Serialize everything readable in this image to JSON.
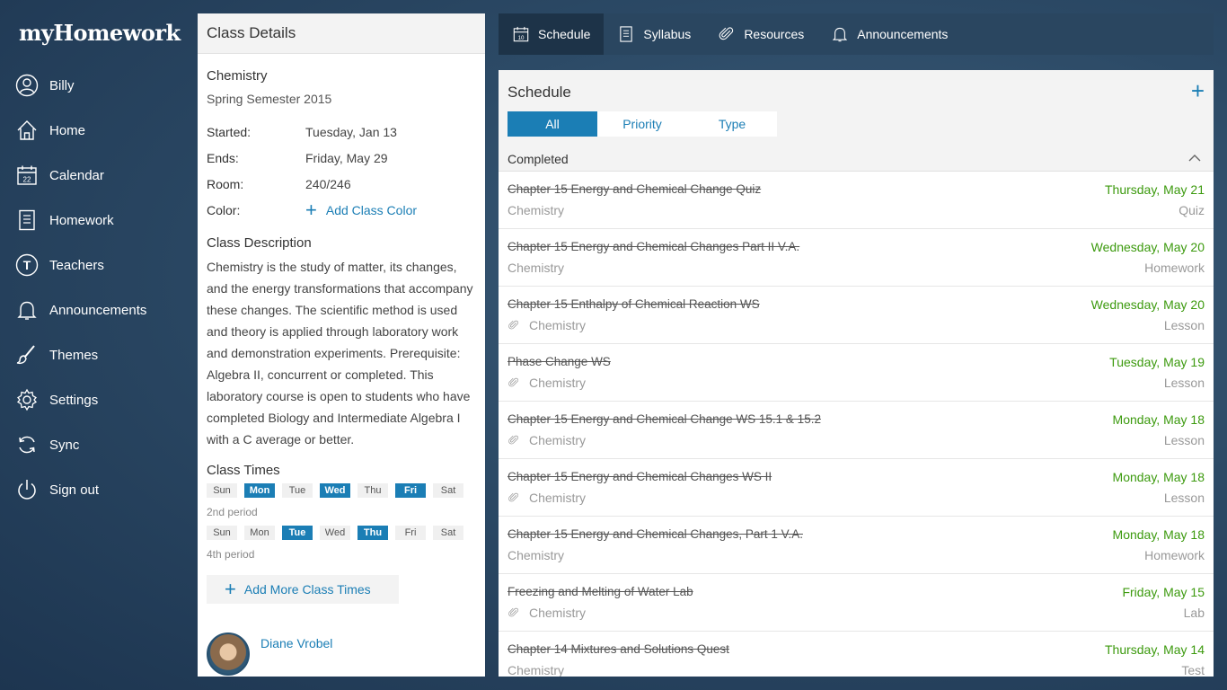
{
  "app": {
    "logo": "myHomework"
  },
  "sidebar": {
    "items": [
      {
        "label": "Billy",
        "icon": "user-icon"
      },
      {
        "label": "Home",
        "icon": "home-icon"
      },
      {
        "label": "Calendar",
        "icon": "calendar-icon"
      },
      {
        "label": "Homework",
        "icon": "document-icon"
      },
      {
        "label": "Teachers",
        "icon": "teacher-icon"
      },
      {
        "label": "Announcements",
        "icon": "bell-icon"
      },
      {
        "label": "Themes",
        "icon": "brush-icon"
      },
      {
        "label": "Settings",
        "icon": "gear-icon"
      },
      {
        "label": "Sync",
        "icon": "sync-icon"
      },
      {
        "label": "Sign out",
        "icon": "power-icon"
      }
    ]
  },
  "details": {
    "header": "Class Details",
    "class_name": "Chemistry",
    "semester": "Spring Semester 2015",
    "started_label": "Started:",
    "started_value": "Tuesday, Jan 13",
    "ends_label": "Ends:",
    "ends_value": "Friday, May 29",
    "room_label": "Room:",
    "room_value": "240/246",
    "color_label": "Color:",
    "add_color": "Add Class Color",
    "desc_title": "Class Description",
    "description": "Chemistry is the study of matter, its changes, and the energy transformations that accompany these changes. The scientific method is used and theory is applied through laboratory work and demonstration experiments. Prerequisite: Algebra II, concurrent or completed. This laboratory course is open to students who have completed Biology and Intermediate Algebra I with a C average or better.",
    "times_title": "Class Times",
    "time_sets": [
      {
        "days": [
          {
            "label": "Sun",
            "on": false
          },
          {
            "label": "Mon",
            "on": true
          },
          {
            "label": "Tue",
            "on": false
          },
          {
            "label": "Wed",
            "on": true
          },
          {
            "label": "Thu",
            "on": false
          },
          {
            "label": "Fri",
            "on": true
          },
          {
            "label": "Sat",
            "on": false
          }
        ],
        "period": "2nd period"
      },
      {
        "days": [
          {
            "label": "Sun",
            "on": false
          },
          {
            "label": "Mon",
            "on": false
          },
          {
            "label": "Tue",
            "on": true
          },
          {
            "label": "Wed",
            "on": false
          },
          {
            "label": "Thu",
            "on": true
          },
          {
            "label": "Fri",
            "on": false
          },
          {
            "label": "Sat",
            "on": false
          }
        ],
        "period": "4th period"
      }
    ],
    "add_times": "Add More Class Times",
    "teacher_name": "Diane Vrobel"
  },
  "tabs": [
    {
      "label": "Schedule",
      "icon": "calendar-icon",
      "active": true
    },
    {
      "label": "Syllabus",
      "icon": "document-icon",
      "active": false
    },
    {
      "label": "Resources",
      "icon": "paperclip-icon",
      "active": false
    },
    {
      "label": "Announcements",
      "icon": "bell-icon",
      "active": false
    }
  ],
  "tab_calendar_day": "10",
  "schedule": {
    "title": "Schedule",
    "filters": [
      {
        "label": "All",
        "active": true
      },
      {
        "label": "Priority",
        "active": false
      },
      {
        "label": "Type",
        "active": false
      }
    ],
    "section": "Completed",
    "items": [
      {
        "title": "Chapter 15 Energy and Chemical Change Quiz",
        "class": "Chemistry",
        "date": "Thursday, May 21",
        "type": "Quiz",
        "attachment": false
      },
      {
        "title": "Chapter 15 Energy and Chemical Changes Part II V.A.",
        "class": "Chemistry",
        "date": "Wednesday, May 20",
        "type": "Homework",
        "attachment": false
      },
      {
        "title": "Chapter 15 Enthalpy of Chemical Reaction WS",
        "class": "Chemistry",
        "date": "Wednesday, May 20",
        "type": "Lesson",
        "attachment": true
      },
      {
        "title": "Phase Change WS",
        "class": "Chemistry",
        "date": "Tuesday, May 19",
        "type": "Lesson",
        "attachment": true
      },
      {
        "title": "Chapter 15 Energy and Chemical Change WS 15.1 & 15.2",
        "class": "Chemistry",
        "date": "Monday, May 18",
        "type": "Lesson",
        "attachment": true
      },
      {
        "title": "Chapter 15 Energy and Chemical Changes WS II",
        "class": "Chemistry",
        "date": "Monday, May 18",
        "type": "Lesson",
        "attachment": true
      },
      {
        "title": "Chapter 15 Energy and Chemical Changes, Part 1 V.A.",
        "class": "Chemistry",
        "date": "Monday, May 18",
        "type": "Homework",
        "attachment": false
      },
      {
        "title": "Freezing and Melting of Water Lab",
        "class": "Chemistry",
        "date": "Friday, May 15",
        "type": "Lab",
        "attachment": true
      },
      {
        "title": "Chapter 14 Mixtures and Solutions Quest",
        "class": "Chemistry",
        "date": "Thursday, May 14",
        "type": "Test",
        "attachment": false
      }
    ]
  },
  "colors": {
    "accent": "#1b7eb5",
    "done_date": "#3c9a0e"
  }
}
